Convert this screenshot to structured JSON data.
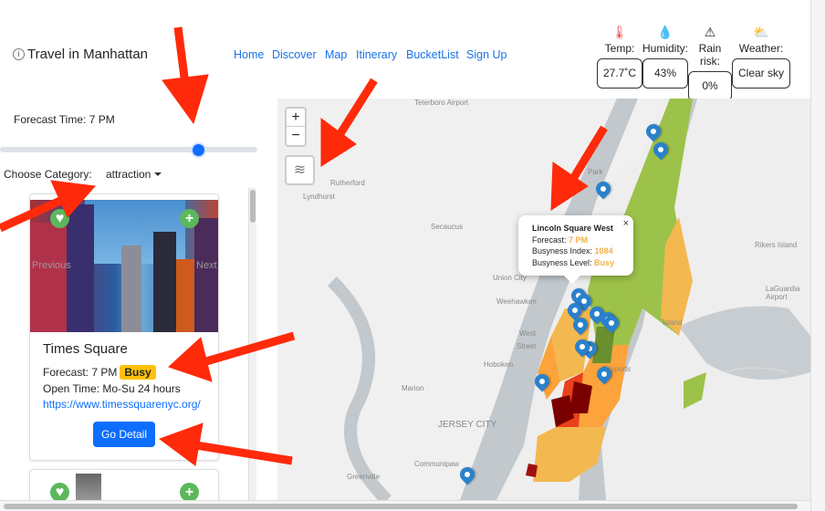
{
  "header": {
    "title": "Travel in Manhattan",
    "title_icon": "info-icon",
    "nav": [
      "Home",
      "Discover",
      "Map",
      "Itinerary",
      "BucketList",
      "Sign Up"
    ]
  },
  "weather": [
    {
      "icon": "thermometer-icon",
      "label": "Temp:",
      "value": "27.7˚C"
    },
    {
      "icon": "humidity-drop-icon",
      "label": "Humidity:",
      "value": "43%"
    },
    {
      "icon": "warning-icon",
      "label": "Rain risk:",
      "value": "0%"
    },
    {
      "icon": "sun-cloud-icon",
      "label": "Weather:",
      "value": "Clear sky"
    }
  ],
  "controls": {
    "forecast_label": "Forecast Time: 7 PM",
    "slider_hour": 19,
    "slider_fraction": 0.77,
    "category_label": "Choose Category:",
    "category_value": "attraction"
  },
  "cards": [
    {
      "name": "Times Square",
      "forecast": "Forecast: 7 PM",
      "busy": "Busy",
      "open": "Open Time: Mo-Su 24 hours",
      "link": "https://www.timessquarenyc.org/",
      "button": "Go Detail",
      "prev": "Previous",
      "next": "Next"
    }
  ],
  "map": {
    "zoom_in": "+",
    "zoom_out": "−",
    "popup": {
      "title": "Lincoln Square West",
      "forecast_label": "Forecast: ",
      "forecast": "7 PM",
      "index_label": "Busyness Index: ",
      "index": "1084",
      "level_label": "Busyness Level: ",
      "level": "Busy",
      "close": "×"
    },
    "labels": [
      "Teterboro Airport",
      "Rutherford",
      "Lyndhurst",
      "Secaucus",
      "Union City",
      "Weehawken",
      "West",
      "Street",
      "Hoboken",
      "Marion",
      "JERSEY CITY",
      "Communipaw",
      "Greenville",
      "Rikers Island",
      "LaGuardia Airport",
      "Skyports",
      "Park",
      "Island"
    ],
    "colors": {
      "very_busy": "#7a0000",
      "busy_red": "#e8411b",
      "busy": "#f3b84f",
      "moderate": "#fca33b",
      "quiet": "#9dc24a",
      "very_quiet": "#6a8f2f",
      "marker": "#2a81cb"
    }
  }
}
